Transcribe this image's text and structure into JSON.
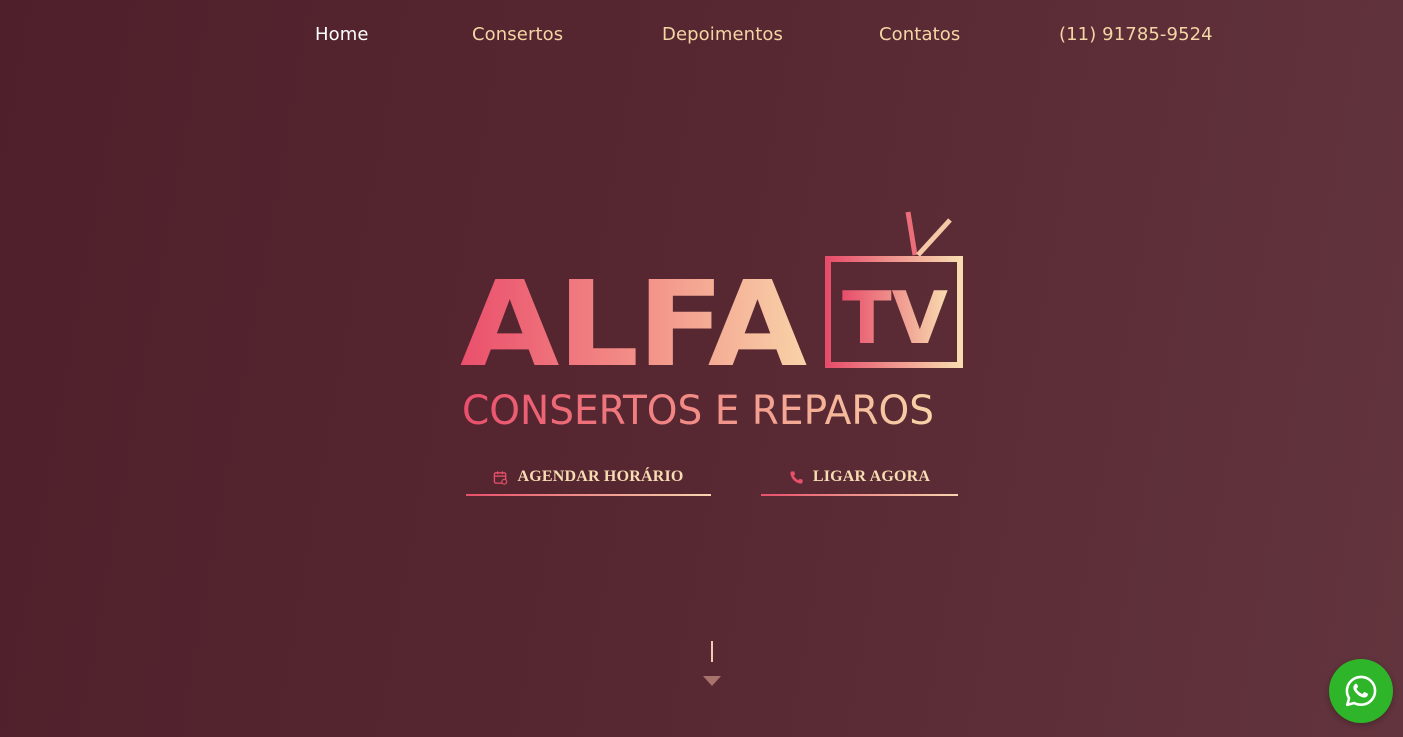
{
  "nav": {
    "home": "Home",
    "consertos": "Consertos",
    "depoimentos": "Depoimentos",
    "contatos": "Contatos",
    "phone": "(11) 91785-9524"
  },
  "logo": {
    "brand": "ALFA",
    "tv": "TV",
    "tagline": "CONSERTOS E REPAROS"
  },
  "cta": {
    "agendar_label": "AGENDAR HORÁRIO",
    "ligar_label": "LIGAR AGORA"
  },
  "colors": {
    "accent_pink": "#e8506b",
    "accent_cream": "#f7d6ae",
    "whatsapp": "#2fb52a"
  },
  "icons": {
    "agendar": "calendar-icon",
    "ligar": "phone-icon",
    "scroll": "arrow-down-icon",
    "whatsapp": "whatsapp-icon"
  }
}
